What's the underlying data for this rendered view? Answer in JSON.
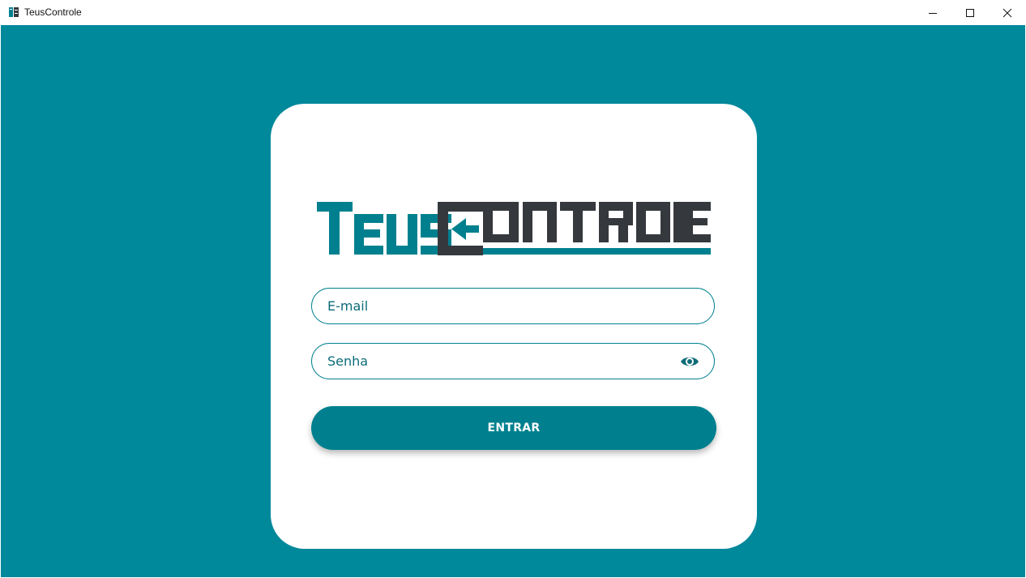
{
  "window": {
    "title": "TeusControle"
  },
  "logo": {
    "text": "TEUSCONTROLE"
  },
  "form": {
    "email_placeholder": "E-mail",
    "password_placeholder": "Senha",
    "submit_label": "ENTRAR"
  },
  "colors": {
    "background": "#00889b",
    "accent": "#00808f",
    "logo_dark": "#35393e",
    "card": "#ffffff"
  },
  "icons": {
    "app": "app-icon",
    "minimize": "minimize-icon",
    "maximize": "maximize-icon",
    "close": "close-icon",
    "password_visibility": "eye-icon"
  }
}
